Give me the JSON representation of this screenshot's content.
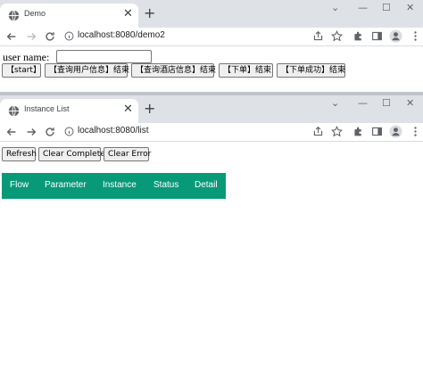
{
  "colors": {
    "tabstrip": "#dee1e6",
    "table_header": "#089a78",
    "table_header_text": "#ffffff",
    "button_bg": "#efefef"
  },
  "window1": {
    "tab": {
      "title": "Demo",
      "favicon": "globe-icon"
    },
    "address": "localhost:8080/demo2",
    "form": {
      "label": "user name:",
      "input_value": ""
    },
    "buttons": {
      "start": "【start】",
      "query_user": "【查询用户信息】结束",
      "query_hotel": "【查询酒店信息】结束",
      "order": "【下单】结束",
      "order_success": "【下单成功】结束"
    }
  },
  "window2": {
    "tab": {
      "title": "Instance List",
      "favicon": "globe-icon"
    },
    "address": "localhost:8080/list",
    "buttons": {
      "refresh": "Refresh",
      "clear_complete": "Clear Complete",
      "clear_error": "Clear Error"
    },
    "table": {
      "columns": [
        "Flow",
        "Parameter",
        "Instance",
        "Status",
        "Detail"
      ]
    }
  },
  "chrome": {
    "new_tab": "+",
    "close": "✕",
    "win_tablist": "⌄",
    "win_min": "—",
    "win_max": "☐",
    "win_close": "✕"
  }
}
